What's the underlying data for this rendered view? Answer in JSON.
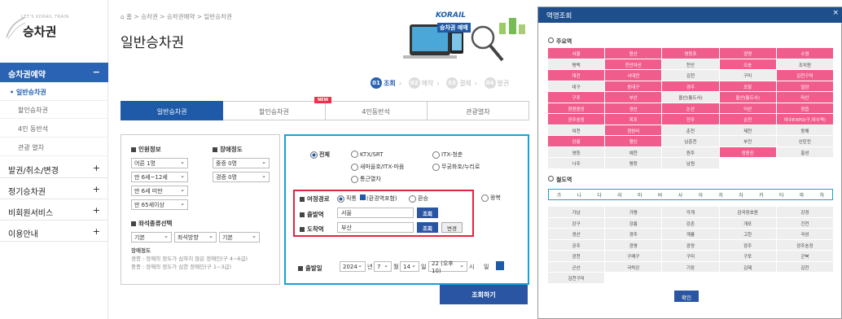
{
  "sidebar": {
    "logo_small": "LET'S KORAIL TRAIN",
    "logo_title": "승차권",
    "active_menu": "승차권예약",
    "active_sign": "−",
    "sub_items": [
      "• 일반승차권",
      "할인승차권",
      "4인 동반석",
      "관광 열차"
    ],
    "menus": [
      {
        "label": "발권/취소/변경",
        "sign": "+"
      },
      {
        "label": "정기승차권",
        "sign": "+"
      },
      {
        "label": "비회원서비스",
        "sign": "+"
      },
      {
        "label": "이용안내",
        "sign": "+"
      }
    ]
  },
  "breadcrumb": "⌂ 홈 > 승차권 > 승차권예약 > 일반승차권",
  "page_title": "일반승차권",
  "banner": {
    "brand": "KORAIL",
    "text": "승차권 예매"
  },
  "steps": [
    {
      "num": "01",
      "label": "조회"
    },
    {
      "num": "02",
      "label": "예약"
    },
    {
      "num": "03",
      "label": "결제"
    },
    {
      "num": "04",
      "label": "발권"
    }
  ],
  "tabs": [
    "일반승차권",
    "할인승차권",
    "4인동반석",
    "관광열차"
  ],
  "new_badge": "NEW",
  "passenger": {
    "heading": "인원정보",
    "adult": "어른 1명",
    "child": "만 6세~12세",
    "toddler": "만 6세 미만",
    "senior": "만 65세이상"
  },
  "disability": {
    "heading": "장애정도",
    "severe": "중증 0명",
    "mild": "경증 0명"
  },
  "seat": {
    "heading": "좌석종류선택",
    "s1": "기본",
    "s2": "좌석방향",
    "s3": "기본"
  },
  "notes": {
    "heading": "장애정도",
    "line1": "경증 : 장애의 정도가 심하지 않은 장애인(구 4~6급)",
    "line2": "중증 : 장애의 정도가 심한 장애인(구 1~3급)"
  },
  "train_types": {
    "all": "전체",
    "ktx": "KTX/SRT",
    "itx_cheong": "ITX-청춘",
    "saemaeul": "새마을호/ITX-마음",
    "mugunghwa": "무궁화호/누리로",
    "commuter": "통근열차"
  },
  "route": {
    "heading": "여정경로",
    "direct": "직통",
    "transfer_inc": "환승",
    "checkbox": "(환경역포함)",
    "roundtrip": "왕복"
  },
  "departure": {
    "label": "출발역",
    "value": "서울",
    "btn": "조회"
  },
  "arrival": {
    "label": "도착역",
    "value": "부산",
    "btn": "조회",
    "swap": "변경"
  },
  "date": {
    "label": "출발일",
    "year": "2024",
    "year_unit": "년",
    "month": "7",
    "month_unit": "월",
    "day": "14",
    "day_unit": "일",
    "hour": "22 (오후10)",
    "hour_unit": "시",
    "extra": "일"
  },
  "search_button": "조회하기",
  "modal": {
    "title": "역명조회",
    "close": "×",
    "major_heading": "주요역",
    "major": [
      {
        "n": "서울",
        "p": true
      },
      {
        "n": "용산",
        "p": true
      },
      {
        "n": "영등포",
        "p": true
      },
      {
        "n": "광명",
        "p": true
      },
      {
        "n": "수원",
        "p": true
      },
      {
        "n": "평택",
        "p": false
      },
      {
        "n": "천안아산",
        "p": true
      },
      {
        "n": "천안",
        "p": false
      },
      {
        "n": "오송",
        "p": true
      },
      {
        "n": "조치원",
        "p": false
      },
      {
        "n": "대전",
        "p": true
      },
      {
        "n": "서대전",
        "p": true
      },
      {
        "n": "김천",
        "p": false
      },
      {
        "n": "구미",
        "p": false
      },
      {
        "n": "김천구미",
        "p": true
      },
      {
        "n": "대구",
        "p": false
      },
      {
        "n": "동대구",
        "p": true
      },
      {
        "n": "경주",
        "p": true
      },
      {
        "n": "포항",
        "p": true
      },
      {
        "n": "밀양",
        "p": true
      },
      {
        "n": "구포",
        "p": true
      },
      {
        "n": "부산",
        "p": true
      },
      {
        "n": "울산(통도사)",
        "p": false
      },
      {
        "n": "울산(통도사)",
        "p": true
      },
      {
        "n": "마산",
        "p": true
      },
      {
        "n": "창원중앙",
        "p": true
      },
      {
        "n": "경산",
        "p": true
      },
      {
        "n": "논산",
        "p": true
      },
      {
        "n": "익산",
        "p": true
      },
      {
        "n": "정읍",
        "p": true
      },
      {
        "n": "광주송정",
        "p": true
      },
      {
        "n": "목포",
        "p": true
      },
      {
        "n": "전주",
        "p": true
      },
      {
        "n": "순천",
        "p": true
      },
      {
        "n": "여수EXPO(구,여수역)",
        "p": true
      },
      {
        "n": "여천",
        "p": false
      },
      {
        "n": "청량리",
        "p": true
      },
      {
        "n": "춘천",
        "p": false
      },
      {
        "n": "제천",
        "p": false
      },
      {
        "n": "동해",
        "p": false
      },
      {
        "n": "강릉",
        "p": true
      },
      {
        "n": "행신",
        "p": true
      },
      {
        "n": "남춘천",
        "p": false
      },
      {
        "n": "부전",
        "p": false
      },
      {
        "n": "신탄진",
        "p": false
      },
      {
        "n": "영등",
        "p": false
      },
      {
        "n": "예천",
        "p": false
      },
      {
        "n": "원주",
        "p": false
      },
      {
        "n": "정동진",
        "p": true
      },
      {
        "n": "홍성",
        "p": false
      },
      {
        "n": "나주",
        "p": false
      },
      {
        "n": "평창",
        "p": false
      },
      {
        "n": "남원",
        "p": false
      }
    ],
    "consonant_heading": "철도역",
    "consonants": [
      "가",
      "나",
      "다",
      "라",
      "마",
      "바",
      "사",
      "아",
      "자",
      "차",
      "카",
      "타",
      "파",
      "하"
    ],
    "stations": [
      "가남",
      "가평",
      "각계",
      "감곡장호원",
      "강경",
      "강구",
      "강릉",
      "강촌",
      "개포",
      "건천",
      "경산",
      "경주",
      "계룡",
      "고한",
      "곡성",
      "공주",
      "광명",
      "광양",
      "광주",
      "광주송정",
      "광천",
      "구례구",
      "구미",
      "구포",
      "군북",
      "군산",
      "극락강",
      "기장",
      "김제",
      "김천",
      "김천구미"
    ],
    "confirm": "확인"
  }
}
